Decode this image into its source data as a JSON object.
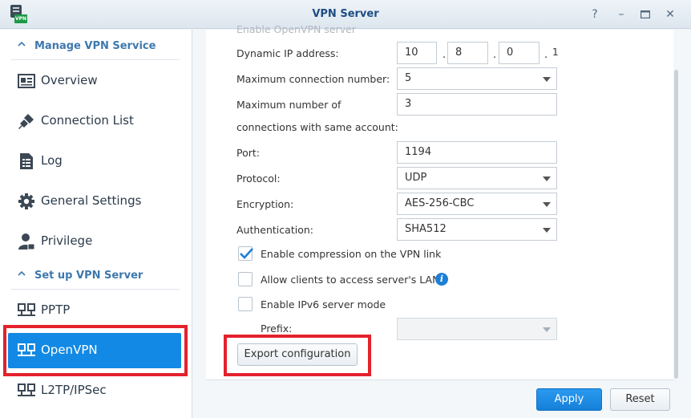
{
  "window": {
    "title": "VPN Server",
    "icon_tag": "VPN",
    "controls": {
      "help": "?",
      "minimize": "–",
      "maximize": "□",
      "close": "✕"
    }
  },
  "sidebar": {
    "sections": [
      {
        "label": "Manage VPN Service"
      },
      {
        "label": "Set up VPN Server"
      }
    ],
    "manage_items": [
      {
        "label": "Overview",
        "icon": "overview-icon"
      },
      {
        "label": "Connection List",
        "icon": "connection-icon"
      },
      {
        "label": "Log",
        "icon": "log-icon"
      },
      {
        "label": "General Settings",
        "icon": "gear-icon"
      },
      {
        "label": "Privilege",
        "icon": "user-icon"
      }
    ],
    "setup_items": [
      {
        "label": "PPTP",
        "icon": "network-icon"
      },
      {
        "label": "OpenVPN",
        "icon": "network-icon",
        "active": true
      },
      {
        "label": "L2TP/IPSec",
        "icon": "network-icon"
      }
    ]
  },
  "form": {
    "enable_openvpn_label": "Enable OpenVPN server",
    "dynamic_ip": {
      "label": "Dynamic IP address:",
      "octets": [
        "10",
        "8",
        "0"
      ],
      "last": "1"
    },
    "max_connection": {
      "label": "Maximum connection number:",
      "value": "5"
    },
    "max_same_account": {
      "label_line1": "Maximum number of",
      "label_line2": "connections with same account:",
      "value": "3"
    },
    "port": {
      "label": "Port:",
      "value": "1194"
    },
    "protocol": {
      "label": "Protocol:",
      "value": "UDP"
    },
    "encryption": {
      "label": "Encryption:",
      "value": "AES-256-CBC"
    },
    "authentication": {
      "label": "Authentication:",
      "value": "SHA512"
    },
    "compression": {
      "label": "Enable compression on the VPN link",
      "checked": true
    },
    "lan_access": {
      "label": "Allow clients to access server's LAN",
      "checked": false
    },
    "ipv6": {
      "label": "Enable IPv6 server mode",
      "checked": false
    },
    "prefix": {
      "label": "Prefix:",
      "value": ""
    },
    "export_button": "Export configuration"
  },
  "footer": {
    "apply": "Apply",
    "reset": "Reset"
  },
  "colors": {
    "accent": "#1289e4",
    "highlight": "#e4212d",
    "title": "#1d4e83",
    "section": "#3e78ad"
  }
}
